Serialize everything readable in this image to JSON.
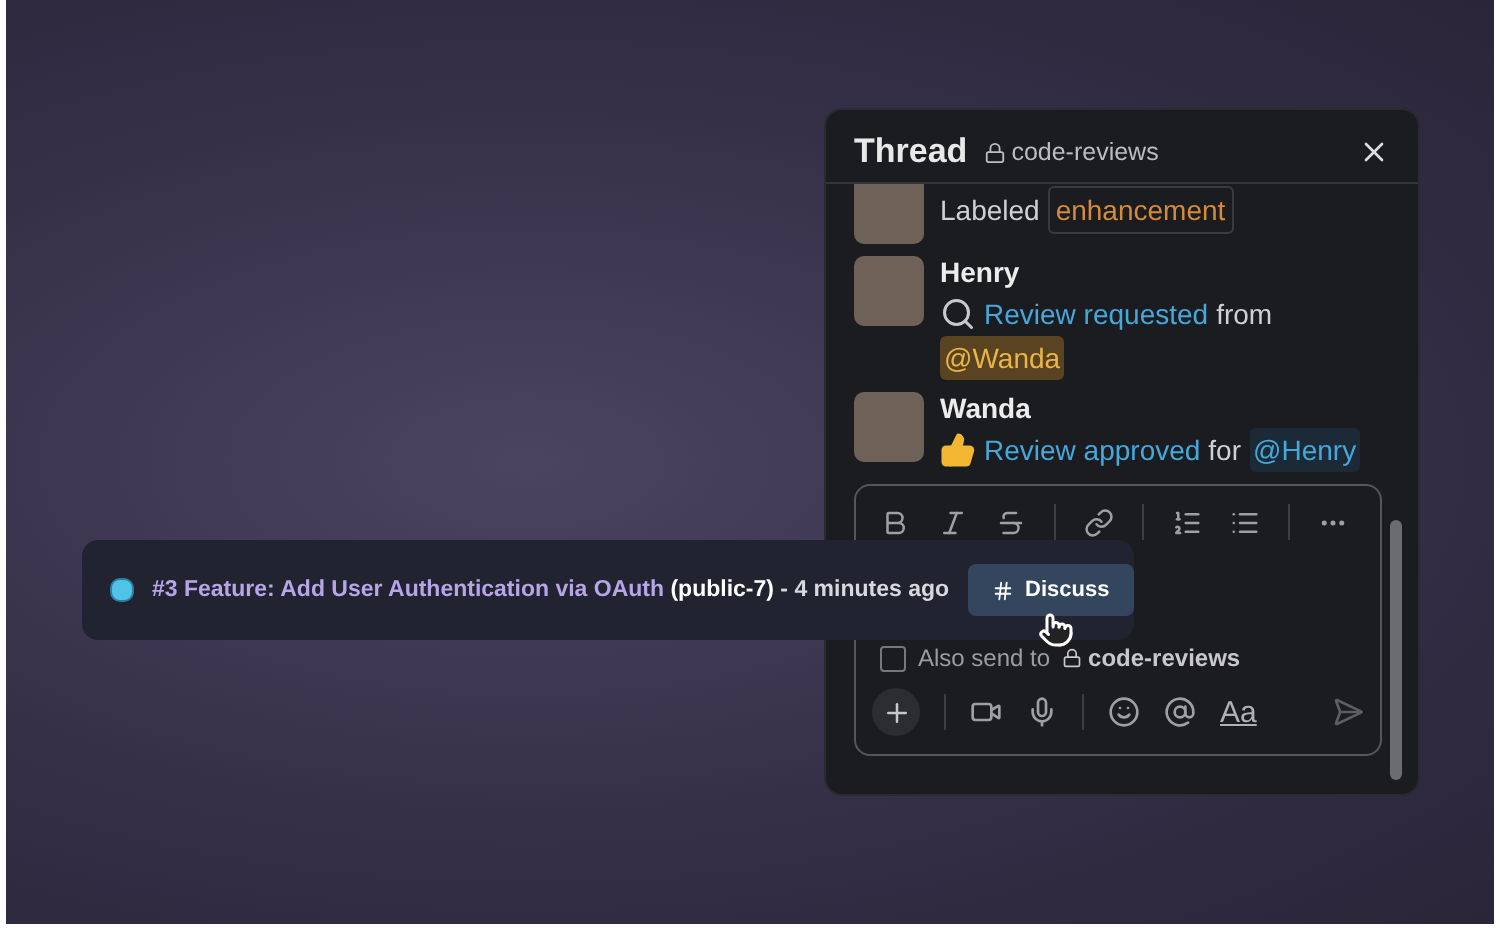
{
  "thread": {
    "title": "Thread",
    "channel": "code-reviews",
    "partial_message": {
      "action": "Labeled",
      "label": "enhancement"
    },
    "messages": [
      {
        "author": "Henry",
        "kind": "request",
        "link": "Review requested",
        "connector": "from",
        "mention": "@Wanda",
        "mention_highlighted": true
      },
      {
        "author": "Wanda",
        "kind": "approval",
        "link": "Review approved",
        "connector": "for",
        "mention": "@Henry",
        "mention_highlighted": false
      }
    ],
    "composer": {
      "also_send": {
        "label": "Also send to",
        "channel": "code-reviews",
        "checked": false
      },
      "format_label": "Aa"
    }
  },
  "notification": {
    "color": "#4fc3e8",
    "title": "#3 Feature: Add User Authentication via OAuth",
    "repo": "(public-7)",
    "time": "- 4 minutes ago",
    "button": "Discuss"
  }
}
